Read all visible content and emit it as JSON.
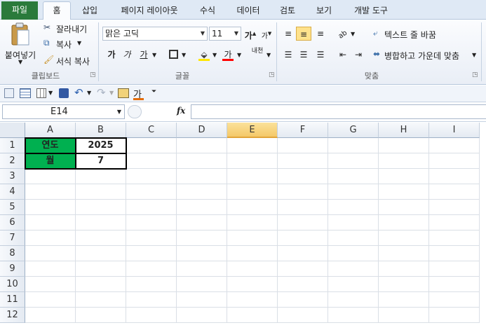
{
  "tabs": [
    "파일",
    "홈",
    "삽입",
    "페이지 레이아웃",
    "수식",
    "데이터",
    "검토",
    "보기",
    "개발 도구"
  ],
  "clipboard": {
    "paste": "붙여넣기",
    "cut": "잘라내기",
    "copy": "복사",
    "format_painter": "서식 복사",
    "group": "클립보드"
  },
  "font": {
    "name": "맑은 고딕",
    "size": "11",
    "group": "글꼴",
    "bold_glyph": "가",
    "italic_glyph": "가",
    "underline_glyph": "가",
    "color_glyph": "가",
    "grow_glyph": "가",
    "shrink_glyph": "가",
    "phonetic_glyph": "내천"
  },
  "alignment": {
    "wrap": "텍스트 줄 바꿈",
    "merge": "병합하고 가운데 맞춤",
    "group": "맞춤"
  },
  "qat": {
    "font_color_glyph": "가"
  },
  "name_box": "E14",
  "fx": "fx",
  "columns": [
    "A",
    "B",
    "C",
    "D",
    "E",
    "F",
    "G",
    "H",
    "I"
  ],
  "selected_column": "E",
  "rows": [
    "1",
    "2",
    "3",
    "4",
    "5",
    "6",
    "7",
    "8",
    "9",
    "10",
    "11",
    "12"
  ],
  "cells": {
    "A1": "연도",
    "B1": "2025",
    "A2": "월",
    "B2": "7"
  },
  "colors": {
    "file_tab": "#2a7a3b",
    "header_fill": "#00b050",
    "selected_header": "#f4c868"
  }
}
